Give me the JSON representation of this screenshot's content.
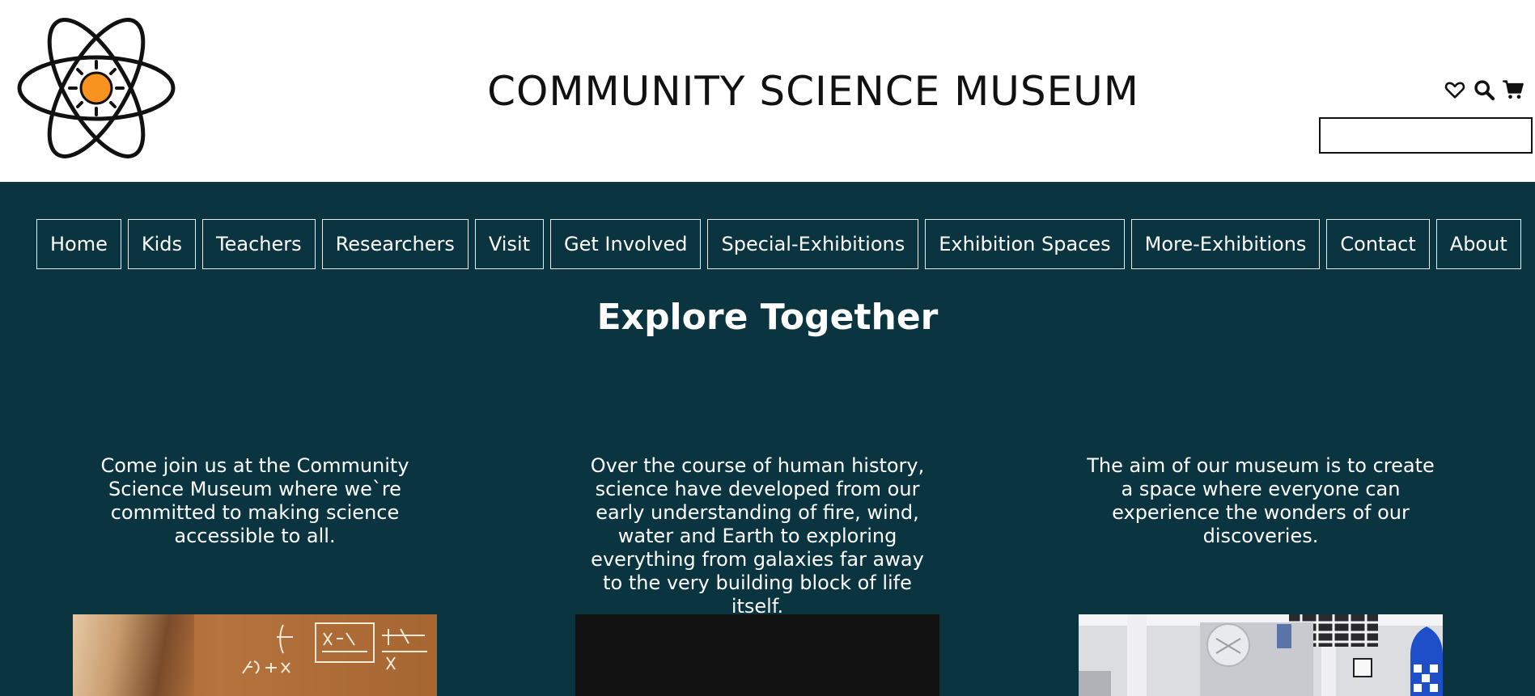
{
  "header": {
    "title": "COMMUNITY SCIENCE MUSEUM",
    "logo_icon": "atom-sun-logo-icon",
    "icons": [
      "heart-icon",
      "search-icon",
      "cart-icon"
    ],
    "search_value": "",
    "accent_color": "#f7931e"
  },
  "nav": {
    "items": [
      {
        "label": "Home"
      },
      {
        "label": "Kids"
      },
      {
        "label": "Teachers"
      },
      {
        "label": "Researchers"
      },
      {
        "label": "Visit"
      },
      {
        "label": "Get Involved"
      },
      {
        "label": "Special-Exhibitions"
      },
      {
        "label": "Exhibition Spaces"
      },
      {
        "label": "More-Exhibitions"
      },
      {
        "label": "Contact"
      },
      {
        "label": "About"
      }
    ]
  },
  "main": {
    "background_color": "#0a3440",
    "heading": "Explore Together",
    "columns": [
      {
        "text": "Come join us at the Community Science Museum where we`re committed to making science accessible to all."
      },
      {
        "text": "Over the course of human history, science have developed from our early understanding of fire, wind, water and Earth to exploring everything from galaxies far away to the very building block of life itself."
      },
      {
        "text": "The aim of our museum is to create a space where everyone can experience the wonders of our discoveries."
      }
    ]
  }
}
